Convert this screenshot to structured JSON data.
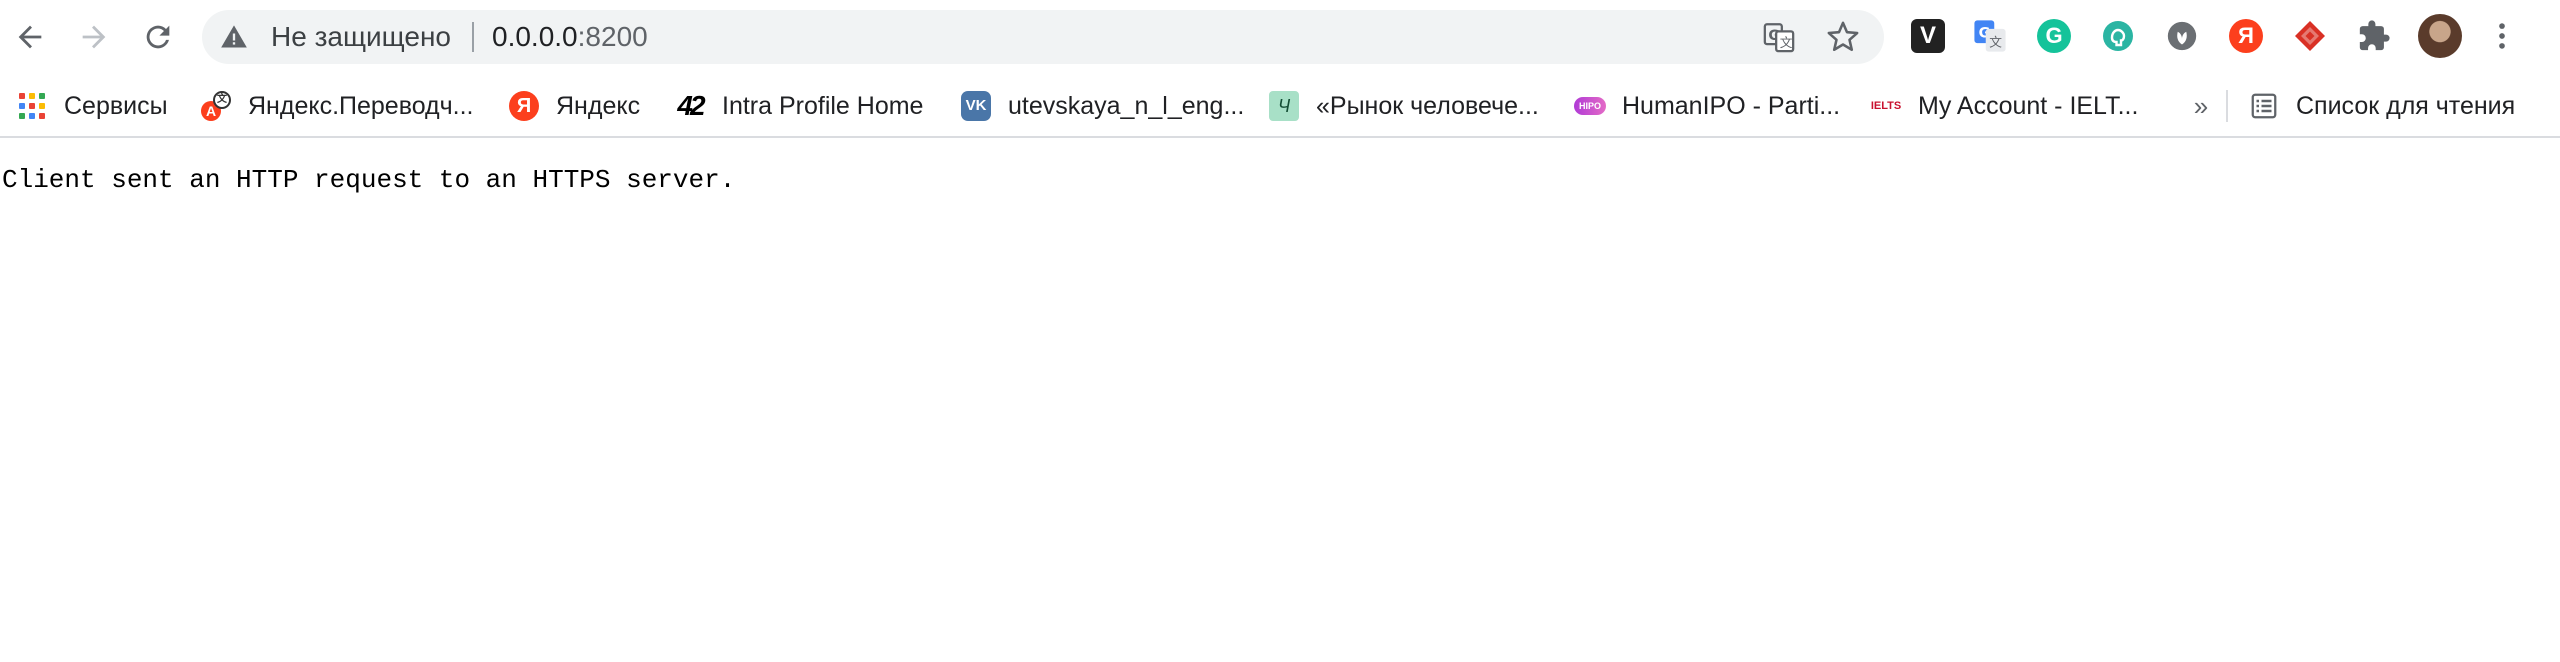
{
  "toolbar": {
    "back_icon": "arrow-back-icon",
    "forward_icon": "arrow-forward-icon",
    "reload_icon": "reload-icon"
  },
  "omnibox": {
    "security_icon": "warning-triangle-icon",
    "security_status": "Не защищено",
    "url_host": "0.0.0.0",
    "url_port": ":8200",
    "translate_icon": "translate-icon",
    "bookmark_icon": "star-icon"
  },
  "extensions": [
    {
      "name": "vivaldi-extension",
      "icon": "v-letter-icon",
      "label": "V"
    },
    {
      "name": "google-translate-extension",
      "icon": "google-translate-icon"
    },
    {
      "name": "grammarly-extension",
      "icon": "grammarly-icon",
      "label": "G"
    },
    {
      "name": "brain-extension",
      "icon": "brain-icon"
    },
    {
      "name": "leaf-extension",
      "icon": "leaf-icon"
    },
    {
      "name": "yandex-extension",
      "icon": "yandex-icon",
      "label": "Я"
    },
    {
      "name": "diamond-extension",
      "icon": "diamond-icon"
    },
    {
      "name": "extensions-menu",
      "icon": "puzzle-icon"
    },
    {
      "name": "profile-avatar",
      "icon": "avatar-icon"
    },
    {
      "name": "chrome-menu",
      "icon": "more-vert-icon"
    }
  ],
  "bookmarks": {
    "items": [
      {
        "label": "Сервисы",
        "icon": "apps-grid-icon"
      },
      {
        "label": "Яндекс.Переводч...",
        "icon": "yandex-translate-icon"
      },
      {
        "label": "Яндекс",
        "icon": "yandex-icon",
        "glyph": "Я"
      },
      {
        "label": "Intra Profile Home",
        "icon": "42-icon",
        "glyph": "42"
      },
      {
        "label": "utevskaya_n_l_eng...",
        "icon": "vk-icon",
        "glyph": "VK"
      },
      {
        "label": "«Рынок человече...",
        "icon": "rynok-icon",
        "glyph": "Ч"
      },
      {
        "label": "HumanIPO - Parti...",
        "icon": "humanipo-icon",
        "glyph": "HIPO"
      },
      {
        "label": "My Account - IELT...",
        "icon": "ielts-icon",
        "glyph": "IELTS"
      }
    ],
    "more_label": "»",
    "reading_list_label": "Список для чтения",
    "reading_list_icon": "reading-list-icon"
  },
  "page": {
    "message": "Client sent an HTTP request to an HTTPS server."
  },
  "colors": {
    "omnibox_bg": "#f1f3f4",
    "apps_grid": [
      "#ea4335",
      "#fbbc05",
      "#34a853",
      "#4285f4",
      "#ea4335",
      "#fbbc05",
      "#34a853",
      "#4285f4",
      "#ea4335"
    ]
  }
}
